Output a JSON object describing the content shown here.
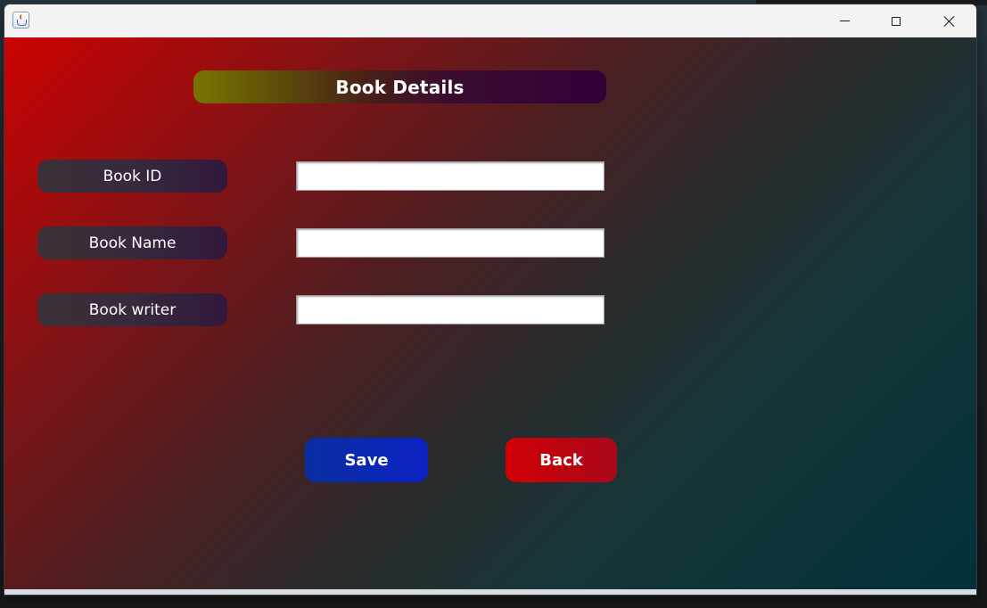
{
  "window": {
    "title": "",
    "icon": "java-app-icon",
    "controls": {
      "minimize_icon": "minimize-icon",
      "maximize_icon": "maximize-icon",
      "close_icon": "close-icon"
    }
  },
  "form": {
    "heading": "Book Details",
    "fields": [
      {
        "label": "Book ID",
        "value": ""
      },
      {
        "label": "Book Name",
        "value": ""
      },
      {
        "label": "Book writer",
        "value": ""
      }
    ],
    "save_label": "Save",
    "back_label": "Back"
  },
  "colors": {
    "background_start": "#cc0202",
    "background_end": "#02313a",
    "save_button": "#0c22c4",
    "back_button": "#c40310",
    "heading_start": "#7a7400",
    "heading_end": "#330038"
  }
}
